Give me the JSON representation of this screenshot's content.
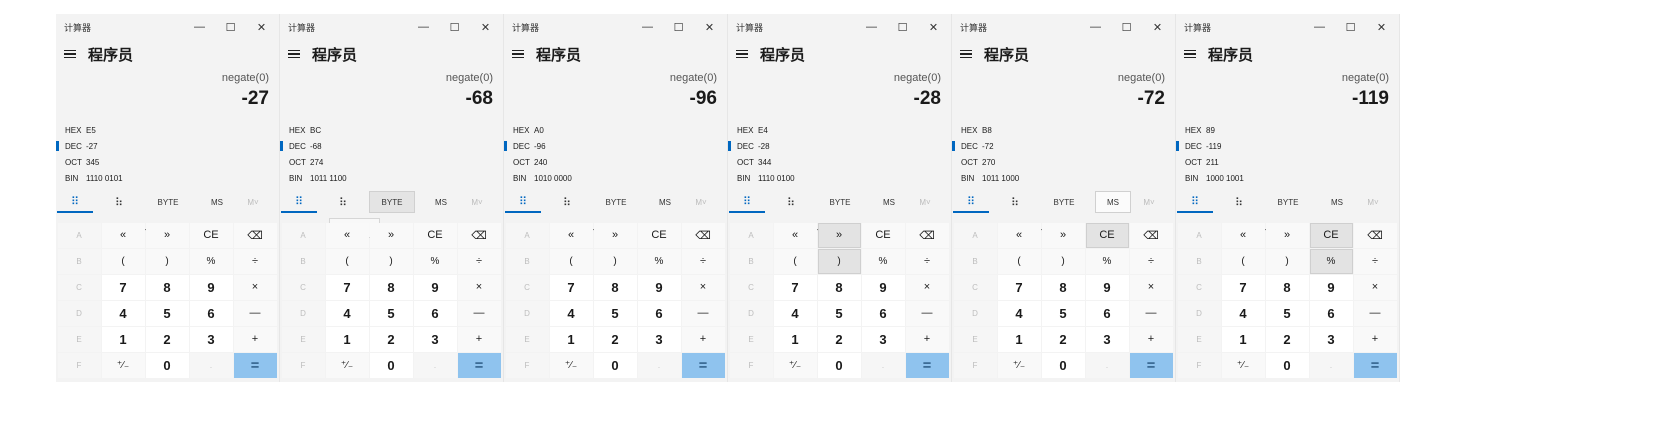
{
  "windows": [
    {
      "title": "计算器",
      "mode": "程序员",
      "expression": "negate(0)",
      "display": "-27",
      "radix": {
        "hex": "E5",
        "dec": "-27",
        "oct": "345",
        "bin": "1110 0101"
      },
      "highlight": []
    },
    {
      "title": "计算器",
      "mode": "程序员",
      "expression": "negate(0)",
      "display": "-68",
      "radix": {
        "hex": "BC",
        "dec": "-68",
        "oct": "274",
        "bin": "1011 1100"
      },
      "highlight": [
        "byte-button",
        "bit-shift-dropdown"
      ]
    },
    {
      "title": "计算器",
      "mode": "程序员",
      "expression": "negate(0)",
      "display": "-96",
      "radix": {
        "hex": "A0",
        "dec": "-96",
        "oct": "240",
        "bin": "1010 0000"
      },
      "highlight": []
    },
    {
      "title": "计算器",
      "mode": "程序员",
      "expression": "negate(0)",
      "display": "-28",
      "radix": {
        "hex": "E4",
        "dec": "-28",
        "oct": "344",
        "bin": "1110 0100"
      },
      "highlight": [
        "right-paren-key",
        "right-shift-key"
      ]
    },
    {
      "title": "计算器",
      "mode": "程序员",
      "expression": "negate(0)",
      "display": "-72",
      "radix": {
        "hex": "B8",
        "dec": "-72",
        "oct": "270",
        "bin": "1011 1000"
      },
      "highlight": [
        "ms-button",
        "ce-key"
      ]
    },
    {
      "title": "计算器",
      "mode": "程序员",
      "expression": "negate(0)",
      "display": "-119",
      "radix": {
        "hex": "89",
        "dec": "-119",
        "oct": "211",
        "bin": "1000 1001"
      },
      "highlight": [
        "percent-key",
        "ce-key"
      ]
    }
  ],
  "labels": {
    "hex": "HEX",
    "dec": "DEC",
    "oct": "OCT",
    "bin": "BIN",
    "byte": "BYTE",
    "ms": "MS",
    "mstar": "M˅",
    "bitwise": "按位",
    "bitshift": "位移位",
    "minimize": "—",
    "maximize": "☐",
    "close": "✕"
  },
  "keys": [
    {
      "label": "A",
      "name": "hex-a-key",
      "kind": "dim"
    },
    {
      "label": "«",
      "name": "left-shift-key",
      "kind": "op"
    },
    {
      "label": "»",
      "name": "right-shift-key",
      "kind": "op"
    },
    {
      "label": "CE",
      "name": "ce-key",
      "kind": "op"
    },
    {
      "label": "⌫",
      "name": "backspace-key",
      "kind": "op"
    },
    {
      "label": "B",
      "name": "hex-b-key",
      "kind": "dim"
    },
    {
      "label": "(",
      "name": "left-paren-key",
      "kind": "small"
    },
    {
      "label": ")",
      "name": "right-paren-key",
      "kind": "small"
    },
    {
      "label": "%",
      "name": "percent-key",
      "kind": "small"
    },
    {
      "label": "÷",
      "name": "divide-key",
      "kind": "op"
    },
    {
      "label": "C",
      "name": "hex-c-key",
      "kind": "dim"
    },
    {
      "label": "7",
      "name": "digit-7-key",
      "kind": "num"
    },
    {
      "label": "8",
      "name": "digit-8-key",
      "kind": "num"
    },
    {
      "label": "9",
      "name": "digit-9-key",
      "kind": "num"
    },
    {
      "label": "×",
      "name": "multiply-key",
      "kind": "op"
    },
    {
      "label": "D",
      "name": "hex-d-key",
      "kind": "dim"
    },
    {
      "label": "4",
      "name": "digit-4-key",
      "kind": "num"
    },
    {
      "label": "5",
      "name": "digit-5-key",
      "kind": "num"
    },
    {
      "label": "6",
      "name": "digit-6-key",
      "kind": "num"
    },
    {
      "label": "—",
      "name": "minus-key",
      "kind": "op"
    },
    {
      "label": "E",
      "name": "hex-e-key",
      "kind": "dim"
    },
    {
      "label": "1",
      "name": "digit-1-key",
      "kind": "num"
    },
    {
      "label": "2",
      "name": "digit-2-key",
      "kind": "num"
    },
    {
      "label": "3",
      "name": "digit-3-key",
      "kind": "num"
    },
    {
      "label": "+",
      "name": "plus-key",
      "kind": "op"
    },
    {
      "label": "F",
      "name": "hex-f-key",
      "kind": "dim"
    },
    {
      "label": "⁺∕₋",
      "name": "negate-key",
      "kind": "small"
    },
    {
      "label": "0",
      "name": "digit-0-key",
      "kind": "num"
    },
    {
      "label": ".",
      "name": "decimal-key",
      "kind": "dim"
    },
    {
      "label": "=",
      "name": "equals-key",
      "kind": "eq"
    }
  ],
  "colors": {
    "accent": "#0067c0",
    "equals": "#8fc3ee"
  }
}
